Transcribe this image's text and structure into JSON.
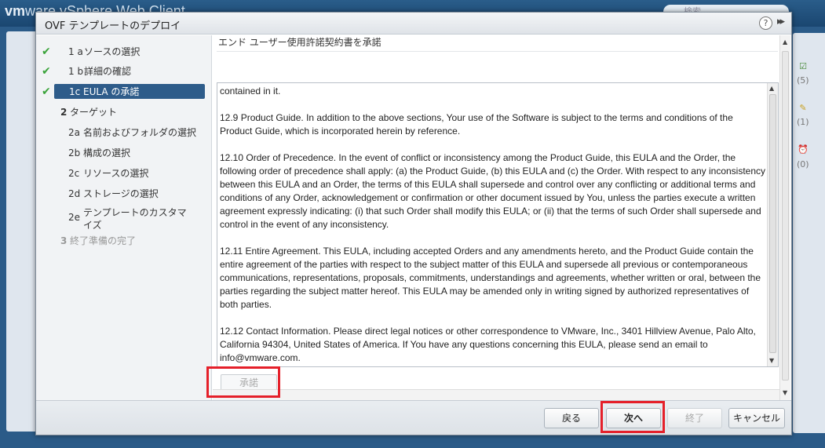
{
  "background": {
    "brand_vm": "vm",
    "brand_rest": "ware vSphere Web Client",
    "search_placeholder": "検索",
    "side_counts": [
      "(5)",
      "(1)",
      "(0)"
    ]
  },
  "dialog": {
    "title": "OVF テンプレートのデプロイ",
    "help": "?",
    "expand": "▸▸"
  },
  "steps": [
    {
      "num": "1 a",
      "label": "ソースの選択",
      "state": "done"
    },
    {
      "num": "1 b",
      "label": "詳細の確認",
      "state": "done"
    },
    {
      "num": "1c",
      "label": "EULA の承諾",
      "state": "active"
    },
    {
      "num": "2",
      "label": "ターゲット",
      "state": "group"
    },
    {
      "num": "2a",
      "label": "名前およびフォルダの選択",
      "state": "pending"
    },
    {
      "num": "2b",
      "label": "構成の選択",
      "state": "pending"
    },
    {
      "num": "2c",
      "label": "リソースの選択",
      "state": "pending"
    },
    {
      "num": "2d",
      "label": "ストレージの選択",
      "state": "pending"
    },
    {
      "num": "2e",
      "label": "テンプレートのカスタマイズ",
      "state": "pending"
    },
    {
      "num": "3",
      "label": "終了準備の完了",
      "state": "disabled"
    }
  ],
  "main": {
    "heading": "エンド ユーザー使用許諾契約書を承諾",
    "eula_paragraphs": [
      "contained in it.",
      "12.9   Product Guide. In addition to the above sections, Your use of the Software is subject to the terms and conditions of the Product Guide, which is incorporated herein by reference.",
      "12.10       Order of Precedence.  In the event of conflict or inconsistency among the Product Guide, this EULA and the Order, the following order of precedence shall apply: (a) the Product Guide, (b) this EULA and (c) the Order. With respect to any inconsistency between this EULA and an Order, the terms of this EULA shall supersede and control over any conflicting or additional terms and conditions of any Order, acknowledgement or confirmation or other document issued by You, unless the parties execute a written agreement expressly indicating: (i) that such Order shall modify this EULA; or (ii) that the terms of such Order shall supersede and control in the event of any inconsistency.",
      "12.11  Entire Agreement.  This EULA, including accepted Orders and any amendments hereto, and the Product Guide contain the entire agreement of the parties with respect to the subject matter of this EULA and supersede all previous or contemporaneous communications, representations, proposals, commitments, understandings and agreements, whether written or oral, between the parties regarding the subject matter hereof.  This EULA may be amended only in writing signed by authorized representatives of both parties.",
      "12.12  Contact Information.  Please direct legal notices or other correspondence to VMware, Inc., 3401 Hillview Avenue, Palo Alto, California 94304, United States of America.  If You have any questions concerning this EULA, please send an email to info@vmware.com."
    ],
    "accept_label": "承諾"
  },
  "footer": {
    "back_label": "戻る",
    "next_label": "次へ",
    "finish_label": "終了",
    "cancel_label": "キャンセル"
  },
  "colors": {
    "active_step": "#2e5c8a",
    "check": "#3aa33a",
    "highlight": "#e5202a"
  }
}
